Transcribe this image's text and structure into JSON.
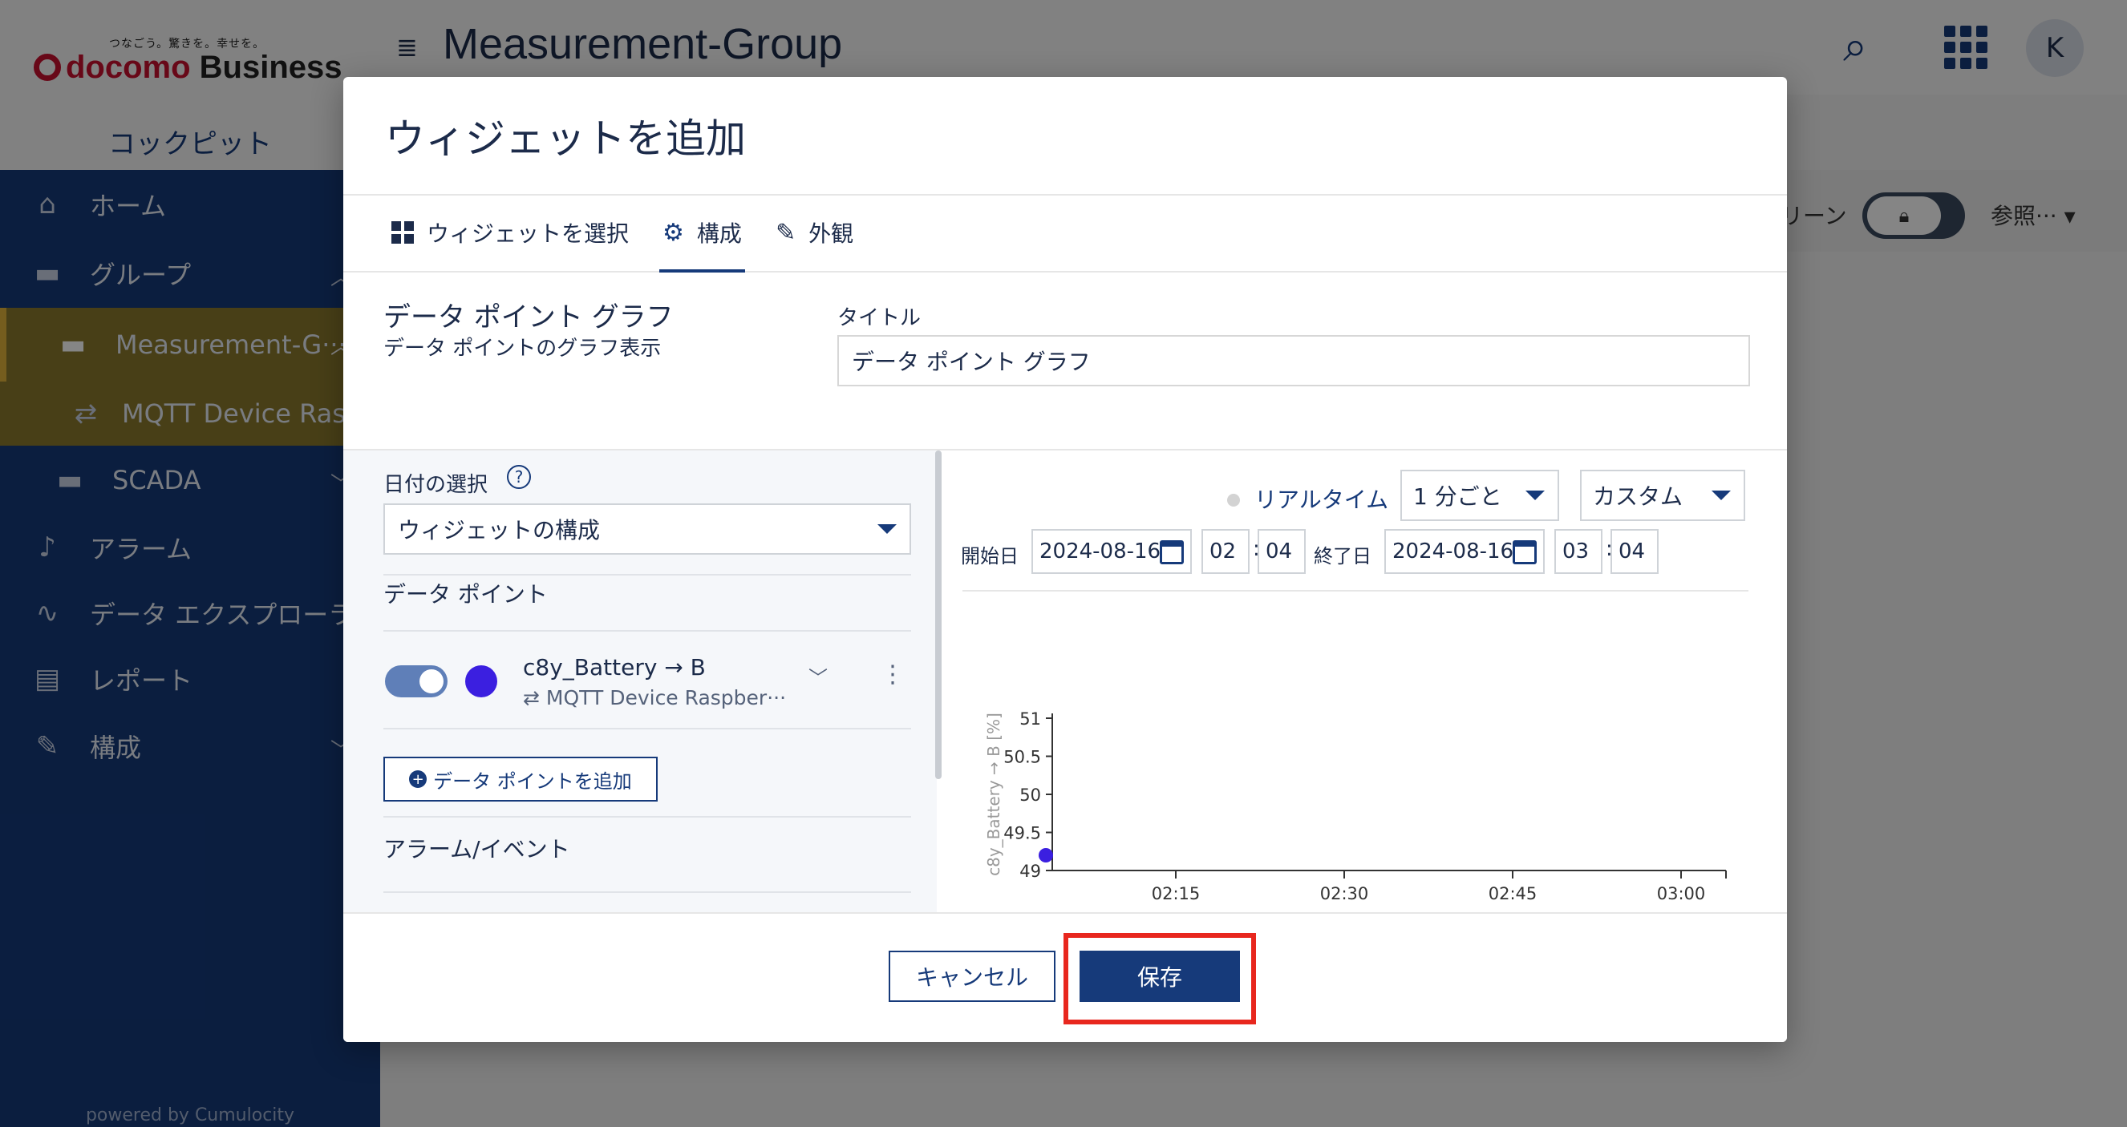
{
  "brand": {
    "tagline": "つなごう。驚きを。幸せを。",
    "logo_primary": "docomo",
    "logo_secondary": "Business",
    "app_name": "コックピット"
  },
  "sidebar": {
    "items": [
      {
        "label": "ホーム",
        "icon": "home-icon"
      },
      {
        "label": "グループ",
        "icon": "folder-icon"
      },
      {
        "label": "Measurement-G···",
        "icon": "folder-icon"
      },
      {
        "label": "MQTT Device Ras···",
        "icon": "device-icon"
      },
      {
        "label": "SCADA",
        "icon": "folder-icon"
      },
      {
        "label": "アラーム",
        "icon": "bell-icon"
      },
      {
        "label": "データ エクスプローラ",
        "icon": "data-explorer-icon"
      },
      {
        "label": "レポート",
        "icon": "report-icon"
      },
      {
        "label": "構成",
        "icon": "config-icon"
      }
    ],
    "powered_by": "powered by Cumulocity"
  },
  "header": {
    "title": "Measurement-Group",
    "avatar_initial": "K"
  },
  "subbar": {
    "fullscreen_label": "リーン",
    "ref_label": "参照···"
  },
  "modal": {
    "title": "ウィジェットを追加",
    "tabs": [
      {
        "label": "ウィジェットを選択",
        "icon": "grid-icon"
      },
      {
        "label": "構成",
        "icon": "gear-icon"
      },
      {
        "label": "外観",
        "icon": "brush-icon"
      }
    ],
    "widget_name": "データ ポイント グラフ",
    "widget_desc": "データ ポイントのグラフ表示",
    "title_label": "タイトル",
    "title_value": "データ ポイント グラフ",
    "date_label": "日付の選択",
    "date_select": "ウィジェットの構成",
    "data_points_label": "データ ポイント",
    "data_point": {
      "name": "c8y_Battery → B",
      "device": "⇄ MQTT Device Raspber···",
      "color": "#3b1fe0"
    },
    "add_data_point": "データ ポイントを追加",
    "alarms_label": "アラーム/イベント",
    "realtime_label": "リアルタイム",
    "interval_value": "1 分ごと",
    "range_value": "カスタム",
    "start_label": "開始日",
    "start_date": "2024-08-16",
    "start_hour": "02",
    "start_minute": "04",
    "end_label": "終了日",
    "end_date": "2024-08-16",
    "end_hour": "03",
    "end_minute": "04",
    "cancel_label": "キャンセル",
    "save_label": "保存"
  },
  "chart_data": {
    "type": "line",
    "ylabel": "c8y_Battery → B [%]",
    "y_ticks": [
      "49",
      "49.5",
      "50",
      "50.5",
      "51"
    ],
    "ylim": [
      49,
      51
    ],
    "x_ticks": [
      "02:15",
      "02:30",
      "02:45",
      "03:00"
    ],
    "xlim": [
      "02:04",
      "03:04"
    ],
    "series": [
      {
        "name": "c8y_Battery → B",
        "color": "#3b1fe0",
        "x": [
          "02:04"
        ],
        "y": [
          49.2
        ]
      }
    ]
  }
}
